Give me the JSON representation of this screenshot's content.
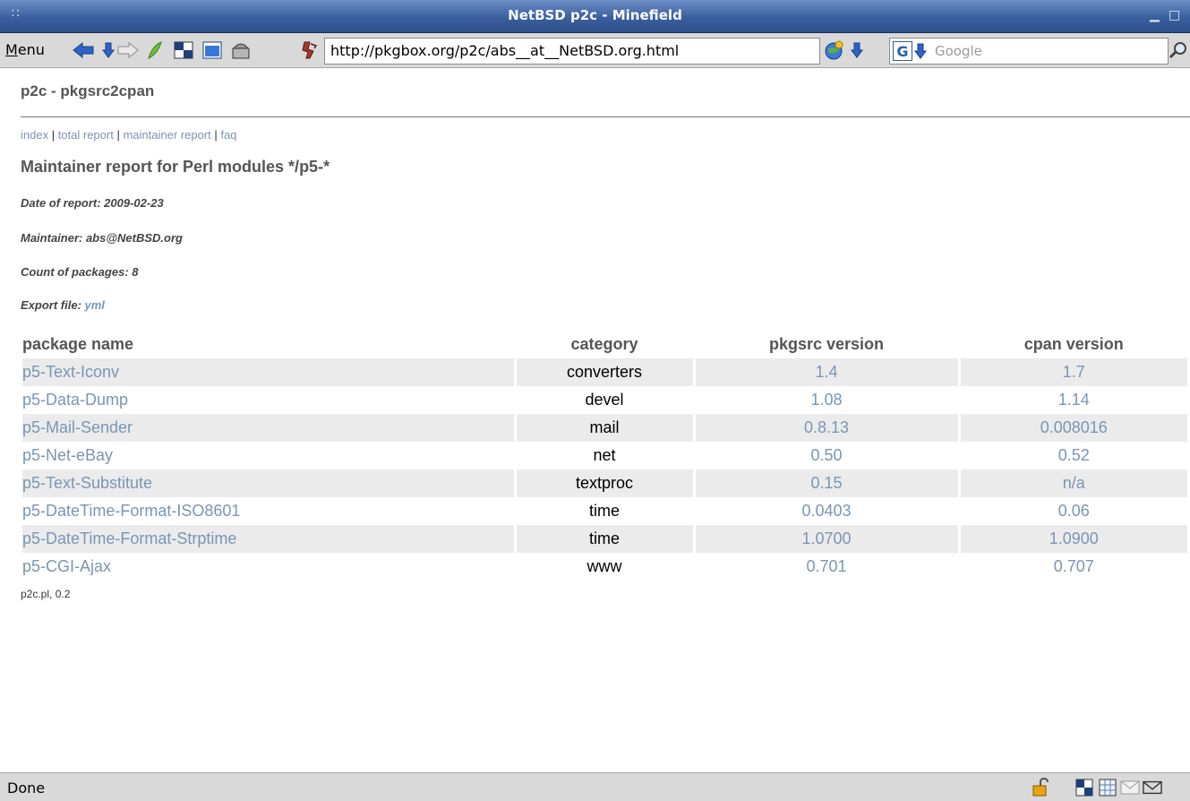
{
  "window": {
    "title": "NetBSD p2c - Minefield",
    "grip": "::",
    "minimize": "▁",
    "maximize": "□"
  },
  "toolbar": {
    "menu_label_underlined": "M",
    "menu_label_rest": "enu",
    "url": "http://pkgbox.org/p2c/abs__at__NetBSD.org.html",
    "search_engine": "G",
    "search_placeholder": "Google"
  },
  "page": {
    "site_title": "p2c - pkgsrc2cpan",
    "nav": [
      {
        "label": "index"
      },
      {
        "label": "total report"
      },
      {
        "label": "maintainer report"
      },
      {
        "label": "faq"
      }
    ],
    "nav_separator": " | ",
    "report_title": "Maintainer report for Perl modules */p5-*",
    "date_label": "Date of report: 2009-02-23",
    "maintainer_label": "Maintainer: abs@NetBSD.org",
    "count_label": "Count of packages: 8",
    "export_label": "Export file: ",
    "export_link": "yml",
    "columns": [
      "package name",
      "category",
      "pkgsrc version",
      "cpan version"
    ],
    "rows": [
      {
        "name": "p5-Text-Iconv",
        "category": "converters",
        "pkgsrc": "1.4",
        "cpan": "1.7"
      },
      {
        "name": "p5-Data-Dump",
        "category": "devel",
        "pkgsrc": "1.08",
        "cpan": "1.14"
      },
      {
        "name": "p5-Mail-Sender",
        "category": "mail",
        "pkgsrc": "0.8.13",
        "cpan": "0.008016"
      },
      {
        "name": "p5-Net-eBay",
        "category": "net",
        "pkgsrc": "0.50",
        "cpan": "0.52"
      },
      {
        "name": "p5-Text-Substitute",
        "category": "textproc",
        "pkgsrc": "0.15",
        "cpan": "n/a"
      },
      {
        "name": "p5-DateTime-Format-ISO8601",
        "category": "time",
        "pkgsrc": "0.0403",
        "cpan": "0.06"
      },
      {
        "name": "p5-DateTime-Format-Strptime",
        "category": "time",
        "pkgsrc": "1.0700",
        "cpan": "1.0900"
      },
      {
        "name": "p5-CGI-Ajax",
        "category": "www",
        "pkgsrc": "0.701",
        "cpan": "0.707"
      }
    ],
    "footer": "p2c.pl, 0.2"
  },
  "status": {
    "text": "Done"
  },
  "colors": {
    "titlebar": "#3a5f9e",
    "link": "#7a95b5",
    "heading": "#555555",
    "row_alt": "#ebebeb"
  }
}
